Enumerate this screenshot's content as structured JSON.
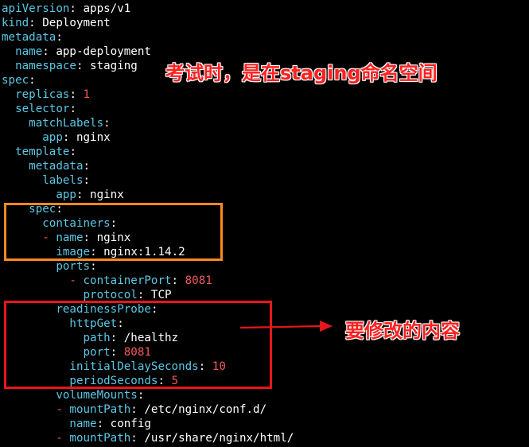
{
  "yaml_lines": [
    {
      "indent": "",
      "key": "apiVersion",
      "sep": ":",
      "value": " apps/v1",
      "value_type": "str"
    },
    {
      "indent": "",
      "key": "kind",
      "sep": ":",
      "value": " Deployment",
      "value_type": "str"
    },
    {
      "indent": "",
      "key": "metadata",
      "sep": ":",
      "value": "",
      "value_type": "str"
    },
    {
      "indent": "  ",
      "key": "name",
      "sep": ":",
      "value": " app-deployment",
      "value_type": "str"
    },
    {
      "indent": "  ",
      "key": "namespace",
      "sep": ":",
      "value": " staging",
      "value_type": "str"
    },
    {
      "indent": "",
      "key": "spec",
      "sep": ":",
      "value": "",
      "value_type": "str"
    },
    {
      "indent": "  ",
      "key": "replicas",
      "sep": ":",
      "value": " 1",
      "value_type": "num"
    },
    {
      "indent": "  ",
      "key": "selector",
      "sep": ":",
      "value": "",
      "value_type": "str"
    },
    {
      "indent": "    ",
      "key": "matchLabels",
      "sep": ":",
      "value": "",
      "value_type": "str"
    },
    {
      "indent": "      ",
      "key": "app",
      "sep": ":",
      "value": " nginx",
      "value_type": "str"
    },
    {
      "indent": "  ",
      "key": "template",
      "sep": ":",
      "value": "",
      "value_type": "str"
    },
    {
      "indent": "    ",
      "key": "metadata",
      "sep": ":",
      "value": "",
      "value_type": "str"
    },
    {
      "indent": "      ",
      "key": "labels",
      "sep": ":",
      "value": "",
      "value_type": "str"
    },
    {
      "indent": "        ",
      "key": "app",
      "sep": ":",
      "value": " nginx",
      "value_type": "str"
    },
    {
      "indent": "    ",
      "key": "spec",
      "sep": ":",
      "value": "",
      "value_type": "str"
    },
    {
      "indent": "      ",
      "key": "containers",
      "sep": ":",
      "value": "",
      "value_type": "str"
    },
    {
      "indent": "      - ",
      "key": "name",
      "sep": ":",
      "value": " nginx",
      "value_type": "str"
    },
    {
      "indent": "        ",
      "key": "image",
      "sep": ":",
      "value": " nginx:1.14.2",
      "value_type": "str"
    },
    {
      "indent": "        ",
      "key": "ports",
      "sep": ":",
      "value": "",
      "value_type": "str"
    },
    {
      "indent": "          - ",
      "key": "containerPort",
      "sep": ":",
      "value": " 8081",
      "value_type": "num"
    },
    {
      "indent": "            ",
      "key": "protocol",
      "sep": ":",
      "value": " TCP",
      "value_type": "str"
    },
    {
      "indent": "        ",
      "key": "readinessProbe",
      "sep": ":",
      "value": "",
      "value_type": "str"
    },
    {
      "indent": "          ",
      "key": "httpGet",
      "sep": ":",
      "value": "",
      "value_type": "str"
    },
    {
      "indent": "            ",
      "key": "path",
      "sep": ":",
      "value": " /healthz",
      "value_type": "str"
    },
    {
      "indent": "            ",
      "key": "port",
      "sep": ":",
      "value": " 8081",
      "value_type": "num"
    },
    {
      "indent": "          ",
      "key": "initialDelaySeconds",
      "sep": ":",
      "value": " 10",
      "value_type": "num"
    },
    {
      "indent": "          ",
      "key": "periodSeconds",
      "sep": ":",
      "value": " 5",
      "value_type": "num"
    },
    {
      "indent": "        ",
      "key": "volumeMounts",
      "sep": ":",
      "value": "",
      "value_type": "str"
    },
    {
      "indent": "        - ",
      "key": "mountPath",
      "sep": ":",
      "value": " /etc/nginx/conf.d/",
      "value_type": "str"
    },
    {
      "indent": "          ",
      "key": "name",
      "sep": ":",
      "value": " config",
      "value_type": "str"
    },
    {
      "indent": "        - ",
      "key": "mountPath",
      "sep": ":",
      "value": " /usr/share/nginx/html/",
      "value_type": "str"
    }
  ],
  "annotations": {
    "namespace_note": "考试时，是在staging命名空间",
    "modify_note": "要修改的内容"
  },
  "colors": {
    "background": "#000000",
    "key": "#5bc8e6",
    "text": "#ffffff",
    "number": "#f25a5a",
    "orange_box": "#ff8a1e",
    "red_box": "#e8161b",
    "note_text": "#ff2020"
  }
}
